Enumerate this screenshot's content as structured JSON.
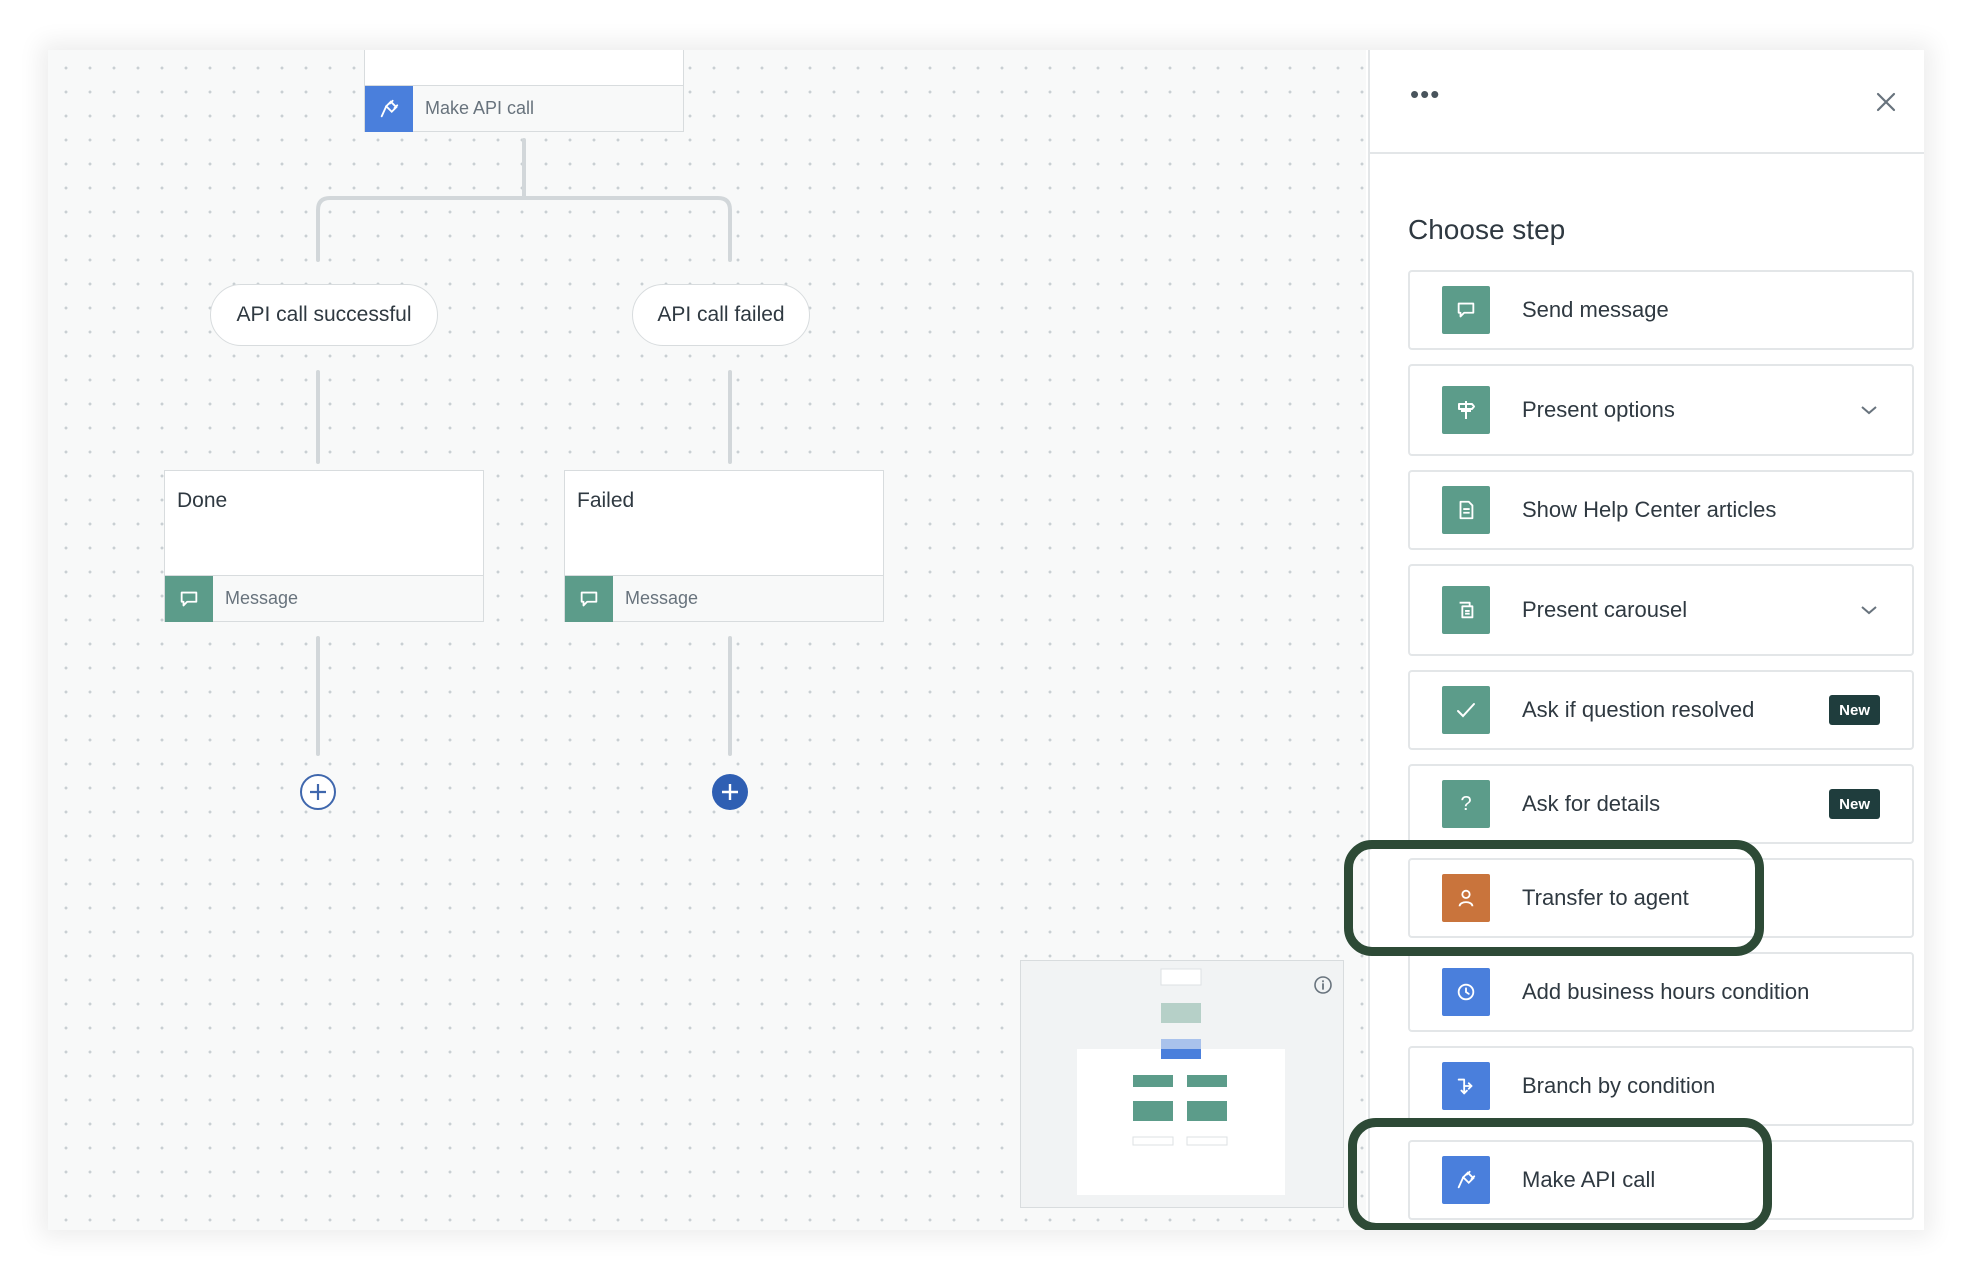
{
  "canvas": {
    "top_node": {
      "label": "Make API call"
    },
    "branches": {
      "success_label": "API call successful",
      "failed_label": "API call failed"
    },
    "nodes": [
      {
        "title": "Done",
        "footer_label": "Message"
      },
      {
        "title": "Failed",
        "footer_label": "Message"
      }
    ]
  },
  "panel": {
    "more_label": "•••",
    "title": "Choose step",
    "steps": [
      {
        "label": "Send message",
        "icon": "speech-bubble-icon",
        "color": "#5c9c8a"
      },
      {
        "label": "Present options",
        "icon": "signpost-icon",
        "color": "#5c9c8a",
        "expandable": true
      },
      {
        "label": "Show Help Center articles",
        "icon": "article-icon",
        "color": "#5c9c8a"
      },
      {
        "label": "Present carousel",
        "icon": "carousel-icon",
        "color": "#5c9c8a",
        "expandable": true
      },
      {
        "label": "Ask if question resolved",
        "icon": "check-icon",
        "color": "#5c9c8a",
        "badge": "New"
      },
      {
        "label": "Ask for details",
        "icon": "question-icon",
        "color": "#5c9c8a",
        "badge": "New"
      },
      {
        "label": "Transfer to agent",
        "icon": "person-icon",
        "color": "#c9743c",
        "highlighted": true
      },
      {
        "label": "Add business hours condition",
        "icon": "clock-icon",
        "color": "#4a7fdc"
      },
      {
        "label": "Branch by condition",
        "icon": "branch-icon",
        "color": "#4a7fdc"
      },
      {
        "label": "Make API call",
        "icon": "plug-icon",
        "color": "#4a7fdc",
        "highlighted": true
      }
    ]
  },
  "colors": {
    "teal": "#5c9c8a",
    "orange": "#c9743c",
    "blue": "#4a7fdc",
    "badge": "#1f3d3d",
    "highlight_outline": "#2d4a36"
  }
}
